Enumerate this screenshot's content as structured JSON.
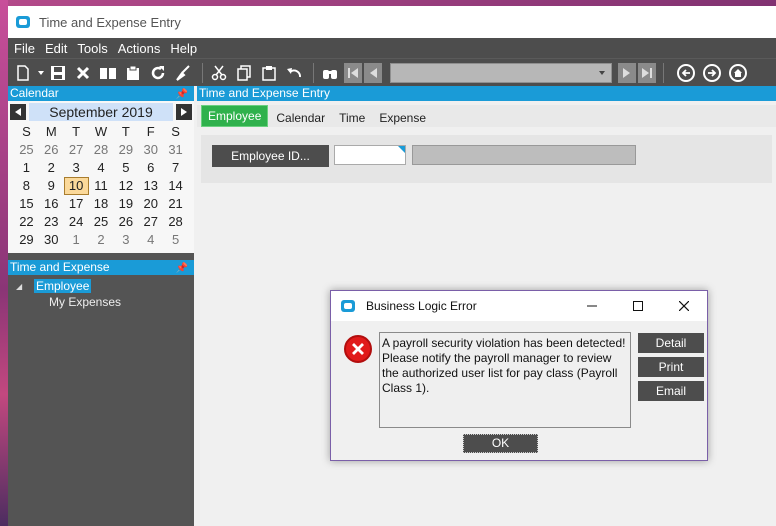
{
  "window": {
    "title": "Time and Expense Entry"
  },
  "menu": [
    "File",
    "Edit",
    "Tools",
    "Actions",
    "Help"
  ],
  "toolbar": {
    "icons": [
      "new-icon",
      "save-icon",
      "delete-icon",
      "book-icon",
      "clipboard-icon",
      "refresh-icon",
      "clear-icon",
      "cut-icon",
      "copy-icon",
      "paste-icon",
      "undo-icon",
      "binoculars-icon",
      "first-record-icon",
      "previous-record-icon",
      "next-record-icon",
      "last-record-icon",
      "back-icon",
      "forward-icon",
      "home-icon"
    ],
    "record_value": ""
  },
  "calendar": {
    "header": "Calendar",
    "month": "September 2019",
    "weekdays": [
      "S",
      "M",
      "T",
      "W",
      "T",
      "F",
      "S"
    ],
    "days": [
      [
        "25",
        "26",
        "27",
        "28",
        "29",
        "30",
        "31"
      ],
      [
        "1",
        "2",
        "3",
        "4",
        "5",
        "6",
        "7"
      ],
      [
        "8",
        "9",
        "10",
        "11",
        "12",
        "13",
        "14"
      ],
      [
        "15",
        "16",
        "17",
        "18",
        "19",
        "20",
        "21"
      ],
      [
        "22",
        "23",
        "24",
        "25",
        "26",
        "27",
        "28"
      ],
      [
        "29",
        "30",
        "1",
        "2",
        "3",
        "4",
        "5"
      ]
    ],
    "today": "10"
  },
  "tree": {
    "header": "Time and Expense",
    "root": "Employee",
    "child": "My Expenses"
  },
  "main": {
    "header": "Time and Expense Entry",
    "tabs": [
      "Employee",
      "Calendar",
      "Time",
      "Expense"
    ],
    "employee_button": "Employee ID...",
    "employee_id": "",
    "employee_name": ""
  },
  "dialog": {
    "title": "Business Logic Error",
    "message": "A payroll security violation has been detected! Please notify the payroll manager to review the authorized user list for pay class (Payroll Class 1).",
    "buttons": {
      "detail": "Detail",
      "print": "Print",
      "email": "Email",
      "ok": "OK"
    }
  },
  "colors": {
    "accent": "#1a9bd7",
    "dark": "#4d4d4d",
    "tab_active": "#2fb14c",
    "error": "#e11a1a",
    "today": "#fbd99a"
  }
}
